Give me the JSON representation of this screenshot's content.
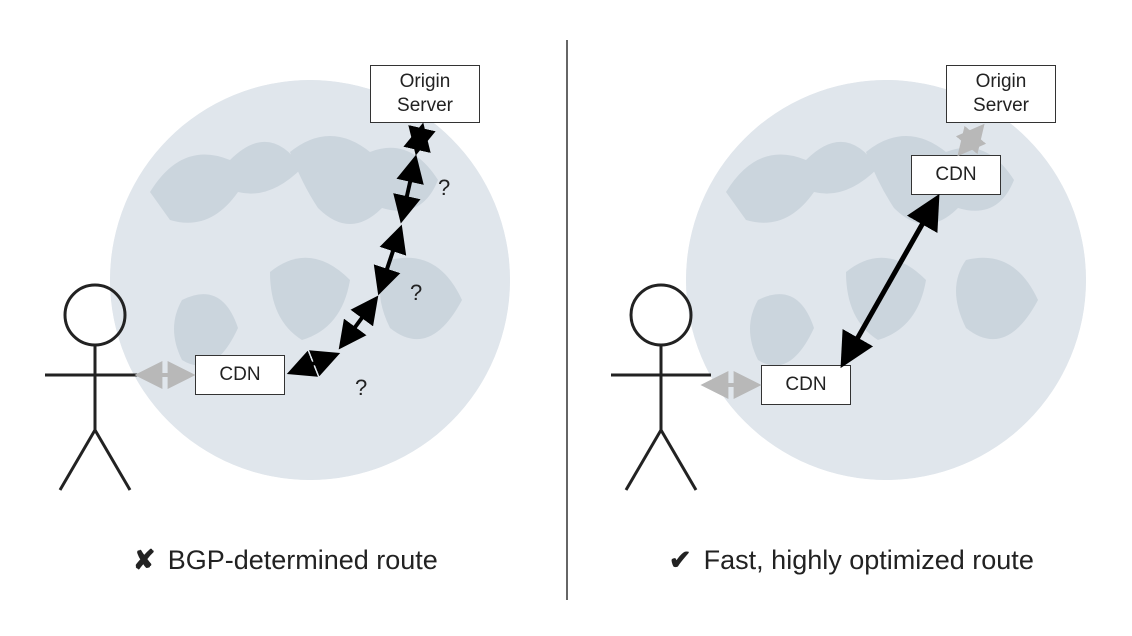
{
  "diagram": {
    "left": {
      "origin_label": "Origin\nServer",
      "cdn_label": "CDN",
      "q1": "?",
      "q2": "?",
      "q3": "?",
      "caption_mark": "✘",
      "caption_text": "BGP-determined route"
    },
    "right": {
      "origin_label": "Origin\nServer",
      "cdn_near_origin_label": "CDN",
      "cdn_near_user_label": "CDN",
      "caption_mark": "✔",
      "caption_text": "Fast, highly optimized route"
    }
  }
}
